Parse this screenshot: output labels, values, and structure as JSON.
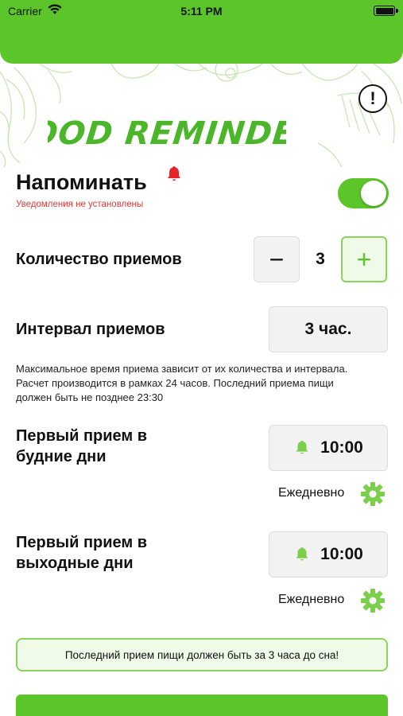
{
  "status_bar": {
    "carrier": "Carrier",
    "time": "5:11 PM"
  },
  "app": {
    "logo_text": "FOOD REMINDER",
    "info_glyph": "!"
  },
  "remind": {
    "title": "Напоминать",
    "subtitle": "Уведомления не установлены",
    "toggle_on": true
  },
  "intakes": {
    "label": "Количество приемов",
    "minus_glyph": "−",
    "plus_glyph": "+",
    "value": "3"
  },
  "interval": {
    "label": "Интервал приемов",
    "value": "3 час."
  },
  "note": "Максимальное время приема зависит от их количества и интервала. Расчет производится в рамках 24 часов. Последний приема пищи должен быть не позднее 23:30",
  "weekdays": {
    "label_line1": "Первый прием в",
    "label_line2": "будние дни",
    "time": "10:00",
    "repeat": "Ежедневно"
  },
  "weekends": {
    "label_line1": "Первый прием в",
    "label_line2": "выходные дни",
    "time": "10:00",
    "repeat": "Ежедневно"
  },
  "banner": "Последний прием пищи должен быть за 3 часа до сна!",
  "colors": {
    "accent": "#5cc529",
    "accent_light": "#effbe8",
    "warning": "#e23a3a",
    "red_bell": "#e8242b"
  },
  "icons": [
    "wifi-icon",
    "battery-icon",
    "info-icon",
    "red-bell-icon",
    "bell-icon",
    "gear-icon"
  ]
}
